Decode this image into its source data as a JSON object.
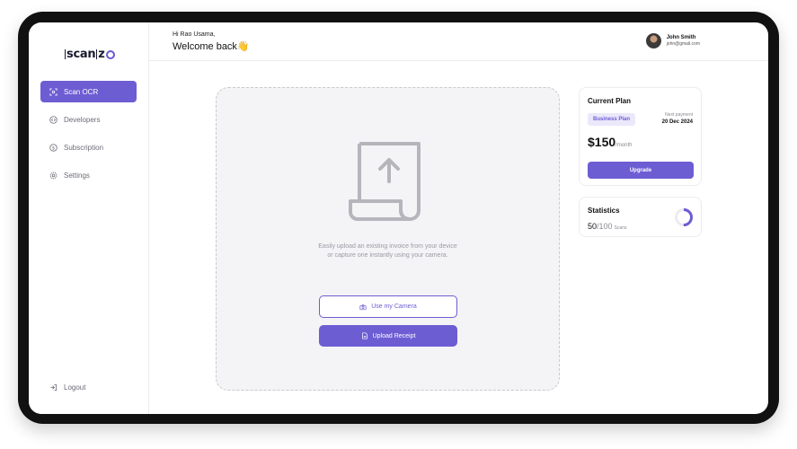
{
  "brand": {
    "logo_text": "scan",
    "logo_suffix": "z"
  },
  "sidebar": {
    "items": [
      {
        "label": "Scan OCR",
        "icon": "scan-icon",
        "active": true
      },
      {
        "label": "Developers",
        "icon": "code-icon",
        "active": false
      },
      {
        "label": "Subscription",
        "icon": "dollar-icon",
        "active": false
      },
      {
        "label": "Settings",
        "icon": "gear-icon",
        "active": false
      }
    ],
    "logout_label": "Logout"
  },
  "header": {
    "greeting_small": "Hi Rao Usama,",
    "greeting_big": "Welcome back👋",
    "user_name": "John Smith",
    "user_email": "john@gmail.com"
  },
  "upload": {
    "text_line1": "Easily upload an existing invoice from your device",
    "text_line2": "or capture one instantly using your camera.",
    "camera_label": "Use my Camera",
    "upload_label": "Upload Receipt"
  },
  "plan": {
    "title": "Current Plan",
    "plan_name": "Business Plan",
    "next_payment_label": "Next payment",
    "next_payment_date": "20 Dec 2024",
    "price": "$150",
    "period": "/month",
    "upgrade_label": "Upgrade"
  },
  "stats": {
    "title": "Statistics",
    "used": "50",
    "total": "/100",
    "unit": "Scans",
    "fraction": 0.5
  },
  "colors": {
    "accent": "#6c5dd3",
    "accent_light": "#ebe8fb"
  }
}
